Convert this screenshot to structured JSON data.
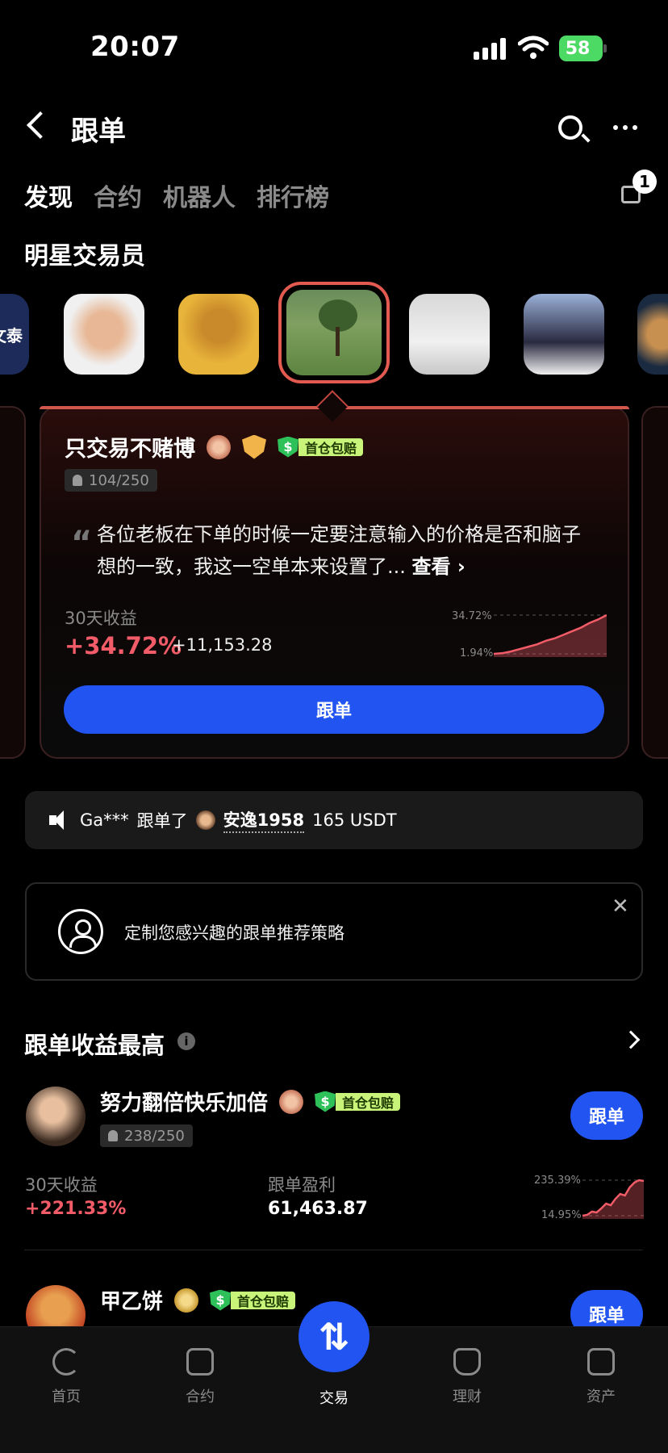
{
  "status_bar": {
    "time": "20:07",
    "battery": "58"
  },
  "header": {
    "title": "跟单"
  },
  "tabs": [
    {
      "label": "发现",
      "active": true
    },
    {
      "label": "合约",
      "active": false
    },
    {
      "label": "机器人",
      "active": false
    },
    {
      "label": "排行榜",
      "active": false
    }
  ],
  "notification_count": "1",
  "star_traders": {
    "title": "明星交易员",
    "first_avatar_text": "文泰"
  },
  "featured": {
    "name": "只交易不赌博",
    "tag": "首仓包赔",
    "followers": "104/250",
    "quote_mark": "“",
    "description": "各位老板在下单的时候一定要注意输入的价格是否和脑子想的一致，我这一空单本来设置了...",
    "see_more": "查看",
    "label_30d": "30天收益",
    "pct_30d": "+34.72%",
    "pnl": "+11,153.28",
    "spark_high": "34.72%",
    "spark_low": "1.94%",
    "spark_values": [
      1.94,
      2.5,
      4,
      6,
      8,
      10,
      13,
      15,
      18,
      21,
      24,
      28,
      31,
      34.72
    ],
    "follow_label": "跟单"
  },
  "ticker": {
    "user": "Ga***",
    "action": "跟单了",
    "trader": "安逸1958",
    "amount": "165 USDT"
  },
  "strategy": {
    "text": "定制您感兴趣的跟单推荐策略",
    "close": "✕"
  },
  "top_earnings": {
    "title": "跟单收益最高",
    "info": "i",
    "rows": [
      {
        "name": "努力翻倍快乐加倍",
        "tag": "首仓包赔",
        "followers": "238/250",
        "label_30d": "30天收益",
        "pct_30d": "+221.33%",
        "label_profit": "跟单盈利",
        "profit": "61,463.87",
        "spark_high": "235.39%",
        "spark_low": "14.95%",
        "spark_values": [
          14.95,
          20,
          40,
          35,
          60,
          90,
          80,
          120,
          150,
          140,
          190,
          220,
          235.39,
          230
        ],
        "follow_label": "跟单"
      },
      {
        "name": "甲乙饼",
        "tag": "首仓包赔",
        "follow_label": "跟单"
      }
    ]
  },
  "bottom_nav": [
    {
      "label": "首页"
    },
    {
      "label": "合约"
    },
    {
      "label": "交易"
    },
    {
      "label": "理财"
    },
    {
      "label": "资产"
    }
  ],
  "fab_icon": "⇅",
  "colors": {
    "accent": "#2154f0",
    "profit": "#f25c68",
    "tag_bg": "#c9f47a"
  }
}
